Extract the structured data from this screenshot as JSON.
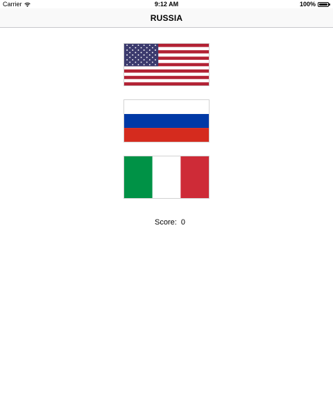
{
  "status_bar": {
    "carrier": "Carrier",
    "time": "9:12 AM",
    "battery": "100%",
    "icons": [
      "wifi-icon",
      "battery-icon"
    ]
  },
  "nav": {
    "title": "RUSSIA"
  },
  "flags": [
    {
      "country": "United States",
      "icon": "us-flag"
    },
    {
      "country": "Russia",
      "icon": "russia-flag"
    },
    {
      "country": "Italy",
      "icon": "italy-flag"
    }
  ],
  "score": {
    "label": "Score:",
    "value": "0"
  },
  "colors": {
    "us_red": "#b22234",
    "us_blue": "#3c3b6e",
    "ru_blue": "#0039a6",
    "ru_red": "#d52b1e",
    "it_green": "#009246",
    "it_red": "#ce2b37",
    "nav_border": "#c8c7cc"
  }
}
